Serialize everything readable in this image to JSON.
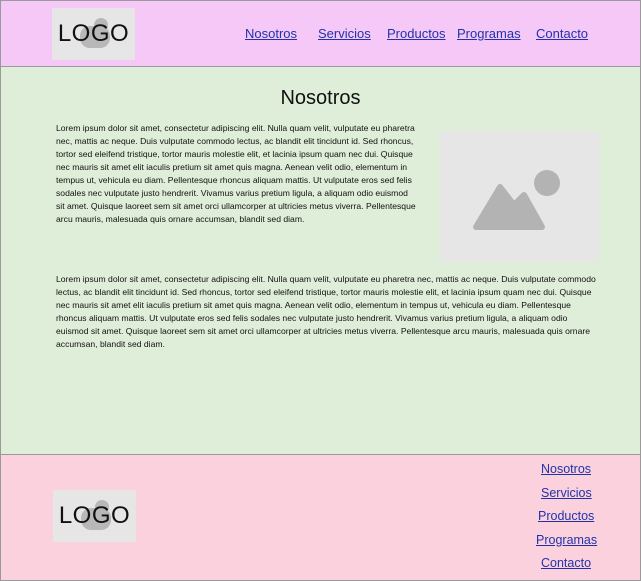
{
  "header": {
    "logo_text": "LOGO",
    "nav": [
      "Nosotros",
      "Servicios",
      "Productos",
      "Programas",
      "Contacto"
    ]
  },
  "main": {
    "title": "Nosotros",
    "paragraph1": "Lorem ipsum dolor sit amet, consectetur adipiscing elit. Nulla quam velit, vulputate eu pharetra nec, mattis ac neque. Duis vulputate commodo lectus, ac blandit elit tincidunt id. Sed rhoncus, tortor sed eleifend tristique, tortor mauris molestie elit, et lacinia ipsum quam nec dui. Quisque nec mauris sit amet elit iaculis pretium sit amet quis magna. Aenean velit odio, elementum in tempus ut, vehicula eu diam. Pellentesque rhoncus aliquam mattis. Ut vulputate eros sed felis sodales nec vulputate justo hendrerit. Vivamus varius pretium ligula, a aliquam odio euismod sit amet. Quisque laoreet sem sit amet orci ullamcorper at ultricies metus viverra. Pellentesque arcu mauris, malesuada quis ornare accumsan, blandit sed diam.",
    "paragraph2": "Lorem ipsum dolor sit amet, consectetur adipiscing elit. Nulla quam velit, vulputate eu pharetra nec, mattis ac neque. Duis vulputate commodo lectus, ac blandit elit tincidunt id. Sed rhoncus, tortor sed eleifend tristique, tortor mauris molestie elit, et lacinia ipsum quam nec dui. Quisque nec mauris sit amet elit iaculis pretium sit amet quis magna. Aenean velit odio, elementum in tempus ut, vehicula eu diam. Pellentesque rhoncus aliquam mattis. Ut vulputate eros sed felis sodales nec vulputate justo hendrerit. Vivamus varius pretium ligula, a aliquam odio euismod sit amet. Quisque laoreet sem sit amet orci ullamcorper at ultricies metus viverra. Pellentesque arcu mauris, malesuada quis ornare accumsan, blandit sed diam.",
    "image_icon": "image-placeholder-icon"
  },
  "footer": {
    "logo_text": "LOGO",
    "nav": [
      "Nosotros",
      "Servicios",
      "Productos",
      "Programas",
      "Contacto"
    ]
  },
  "colors": {
    "header_bg": "#f5c8f7",
    "main_bg": "#dfeed8",
    "footer_bg": "#fbd1dd",
    "link": "#2233aa"
  }
}
